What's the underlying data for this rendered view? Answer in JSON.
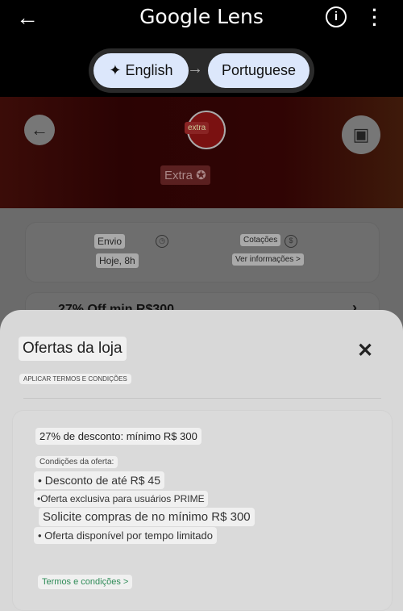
{
  "app": {
    "title": "Google Lens"
  },
  "language": {
    "source": "English",
    "target": "Portuguese"
  },
  "hero": {
    "logo_text": "extra",
    "brand_label": "Extra ✪"
  },
  "store_info": {
    "shipping_label": "Envio",
    "shipping_value": "Hoje, 8h",
    "quotes_label": "Cotações",
    "quotes_link": "Ver informações >"
  },
  "offer_banner": {
    "text": "27% Off min R$300"
  },
  "sheet": {
    "title": "Ofertas da loja",
    "subtitle": "APLICAR TERMOS E CONDIÇÕES",
    "offer_title": "27% de desconto: mínimo R$ 300",
    "conditions_label": "Condições da oferta:",
    "conditions": [
      "• Desconto de até R$ 45",
      "•Oferta exclusiva para usuários PRIME",
      "Solicite compras de no mínimo R$ 300",
      "• Oferta disponível por tempo limitado"
    ],
    "terms_link": "Termos e condições >"
  },
  "colors": {
    "link": "#2e8b57",
    "pill": "#dce7fb"
  }
}
